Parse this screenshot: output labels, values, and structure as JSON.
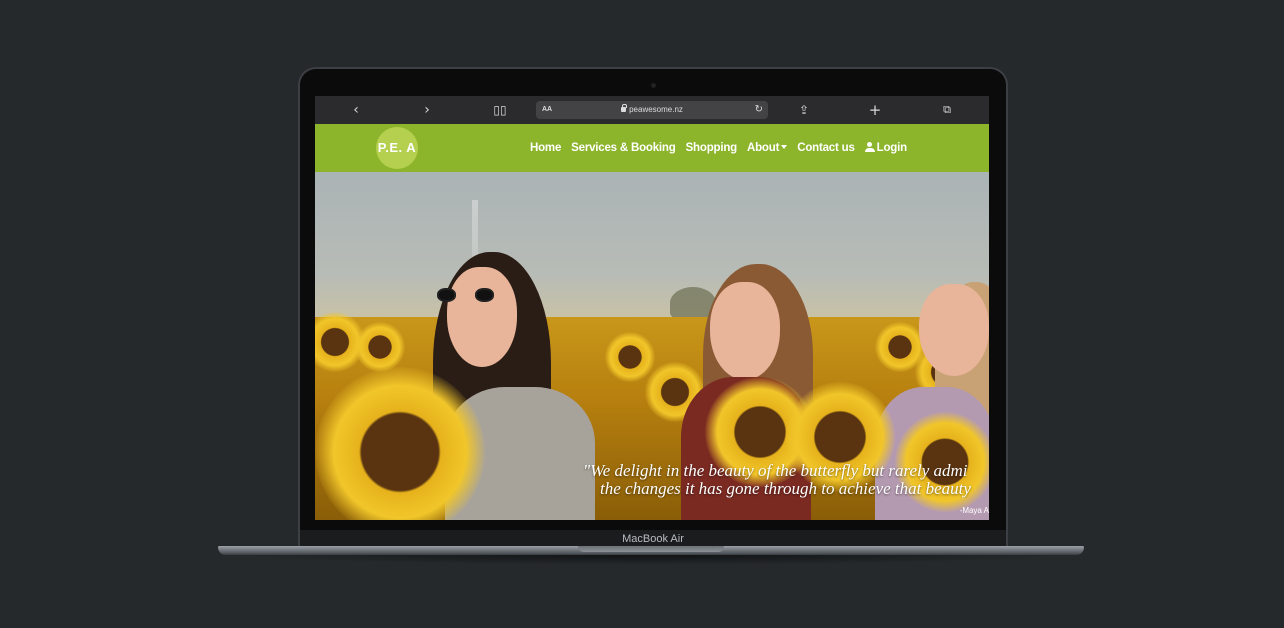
{
  "device": {
    "model_label": "MacBook Air"
  },
  "browser": {
    "back_icon": "chevron-left-icon",
    "forward_icon": "chevron-right-icon",
    "reader_icon": "book-icon",
    "text_size_label": "AA",
    "url": "peawesome.nz",
    "share_icon": "share-icon",
    "new_tab_icon": "plus-icon",
    "tabs_icon": "tabs-icon"
  },
  "site": {
    "logo_text": "P.E. A",
    "brand_color": "#8db52c",
    "nav": {
      "home": "Home",
      "services": "Services & Booking",
      "shopping": "Shopping",
      "about": "About",
      "contact": "Contact us",
      "login": "Login"
    }
  },
  "hero": {
    "quote_line1": "\"We delight in the beauty of the butterfly but rarely admi",
    "quote_line2": "the changes it has gone through to achieve that beauty",
    "quote_author": "-Maya A"
  }
}
